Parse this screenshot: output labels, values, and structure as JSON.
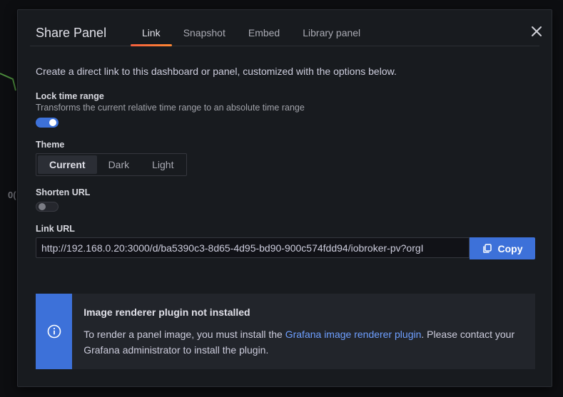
{
  "background": {
    "chart_label": "0("
  },
  "modal": {
    "title": "Share Panel",
    "tabs": [
      {
        "label": "Link",
        "active": true
      },
      {
        "label": "Snapshot",
        "active": false
      },
      {
        "label": "Embed",
        "active": false
      },
      {
        "label": "Library panel",
        "active": false
      }
    ],
    "close_icon": "close-icon"
  },
  "link": {
    "description": "Create a direct link to this dashboard or panel, customized with the options below.",
    "lock_time_range": {
      "label": "Lock time range",
      "description": "Transforms the current relative time range to an absolute time range",
      "enabled": true
    },
    "theme": {
      "label": "Theme",
      "options": [
        "Current",
        "Dark",
        "Light"
      ],
      "selected": "Current"
    },
    "shorten_url": {
      "label": "Shorten URL",
      "enabled": false
    },
    "link_url": {
      "label": "Link URL",
      "value": "http://192.168.0.20:3000/d/ba5390c3-8d65-4d95-bd90-900c574fdd94/iobroker-pv?orgI",
      "copy_label": "Copy",
      "copy_icon": "copy-icon"
    },
    "alert": {
      "icon": "info-circle-icon",
      "title": "Image renderer plugin not installed",
      "text_before": "To render a panel image, you must install the ",
      "link_text": "Grafana image renderer plugin",
      "text_after": ". Please contact your Grafana administrator to install the plugin."
    }
  },
  "colors": {
    "primary": "#3d71d9",
    "tab_underline": "#f55f3e",
    "modal_bg": "#181b1f",
    "alert_bg": "#22252b",
    "link": "#6e9fff"
  }
}
